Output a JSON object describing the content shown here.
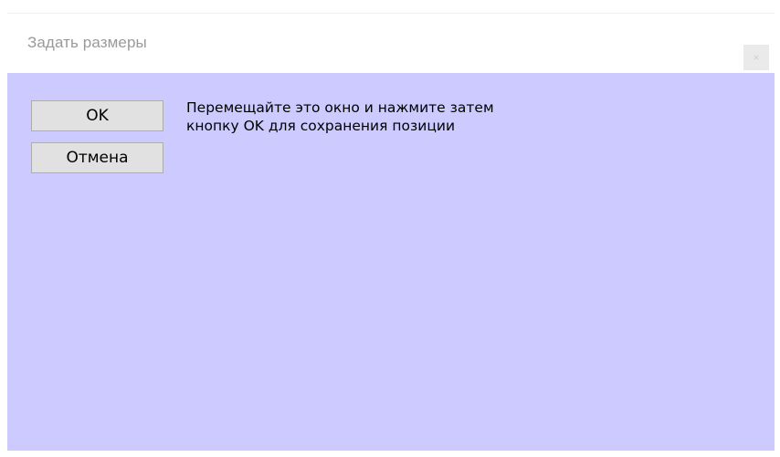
{
  "window": {
    "title": "Задать размеры",
    "close_label": "×"
  },
  "buttons": {
    "ok_label": "OK",
    "cancel_label": "Отмена"
  },
  "message": {
    "line1": "Перемещайте это окно и нажмите затем",
    "line2": "кнопку OK для сохранения позиции"
  },
  "colors": {
    "client_background": "#cccaff",
    "button_face": "#e1e1e1",
    "title_text": "#9a9a9a"
  }
}
